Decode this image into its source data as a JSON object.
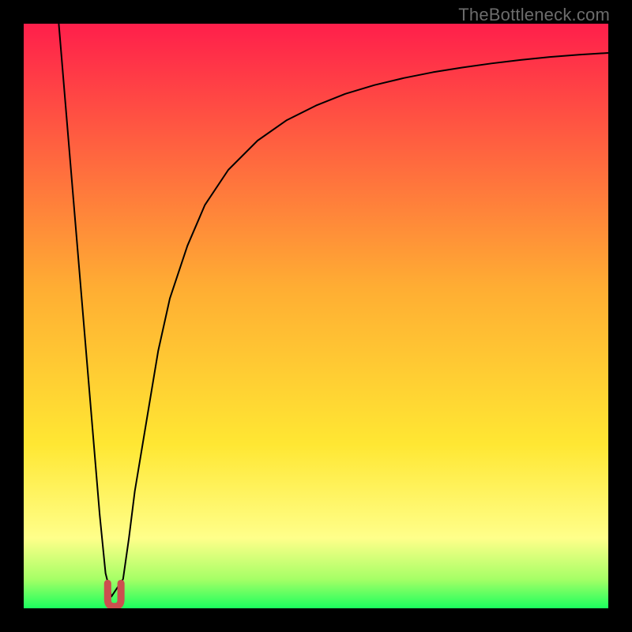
{
  "watermark": "TheBottleneck.com",
  "chart_data": {
    "type": "line",
    "title": "",
    "xlabel": "",
    "ylabel": "",
    "xlim": [
      0,
      100
    ],
    "ylim": [
      0,
      100
    ],
    "grid": false,
    "legend": false,
    "background": {
      "gradient_stops": [
        {
          "offset": 0.0,
          "color": "#ff1f4b"
        },
        {
          "offset": 0.45,
          "color": "#ffad33"
        },
        {
          "offset": 0.72,
          "color": "#ffe733"
        },
        {
          "offset": 0.88,
          "color": "#ffff8a"
        },
        {
          "offset": 0.95,
          "color": "#a6ff66"
        },
        {
          "offset": 1.0,
          "color": "#1bff5e"
        }
      ]
    },
    "series": [
      {
        "name": "curve",
        "color": "#000000",
        "width": 2,
        "x": [
          6,
          7,
          8,
          9,
          10,
          11,
          12,
          13,
          14,
          15,
          17,
          18,
          19,
          21,
          23,
          25,
          28,
          31,
          35,
          40,
          45,
          50,
          55,
          60,
          65,
          70,
          75,
          80,
          85,
          90,
          95,
          100
        ],
        "values": [
          100,
          88,
          76,
          64,
          52,
          40,
          28,
          16,
          6,
          2,
          5,
          12,
          20,
          32,
          44,
          53,
          62,
          69,
          75,
          80,
          83.5,
          86,
          88,
          89.5,
          90.7,
          91.7,
          92.5,
          93.2,
          93.8,
          94.3,
          94.7,
          95
        ]
      },
      {
        "name": "marker",
        "type": "marker",
        "color": "#cc4f4f",
        "x": 15.5,
        "y": 2,
        "shape": "u",
        "size": 14
      }
    ]
  }
}
